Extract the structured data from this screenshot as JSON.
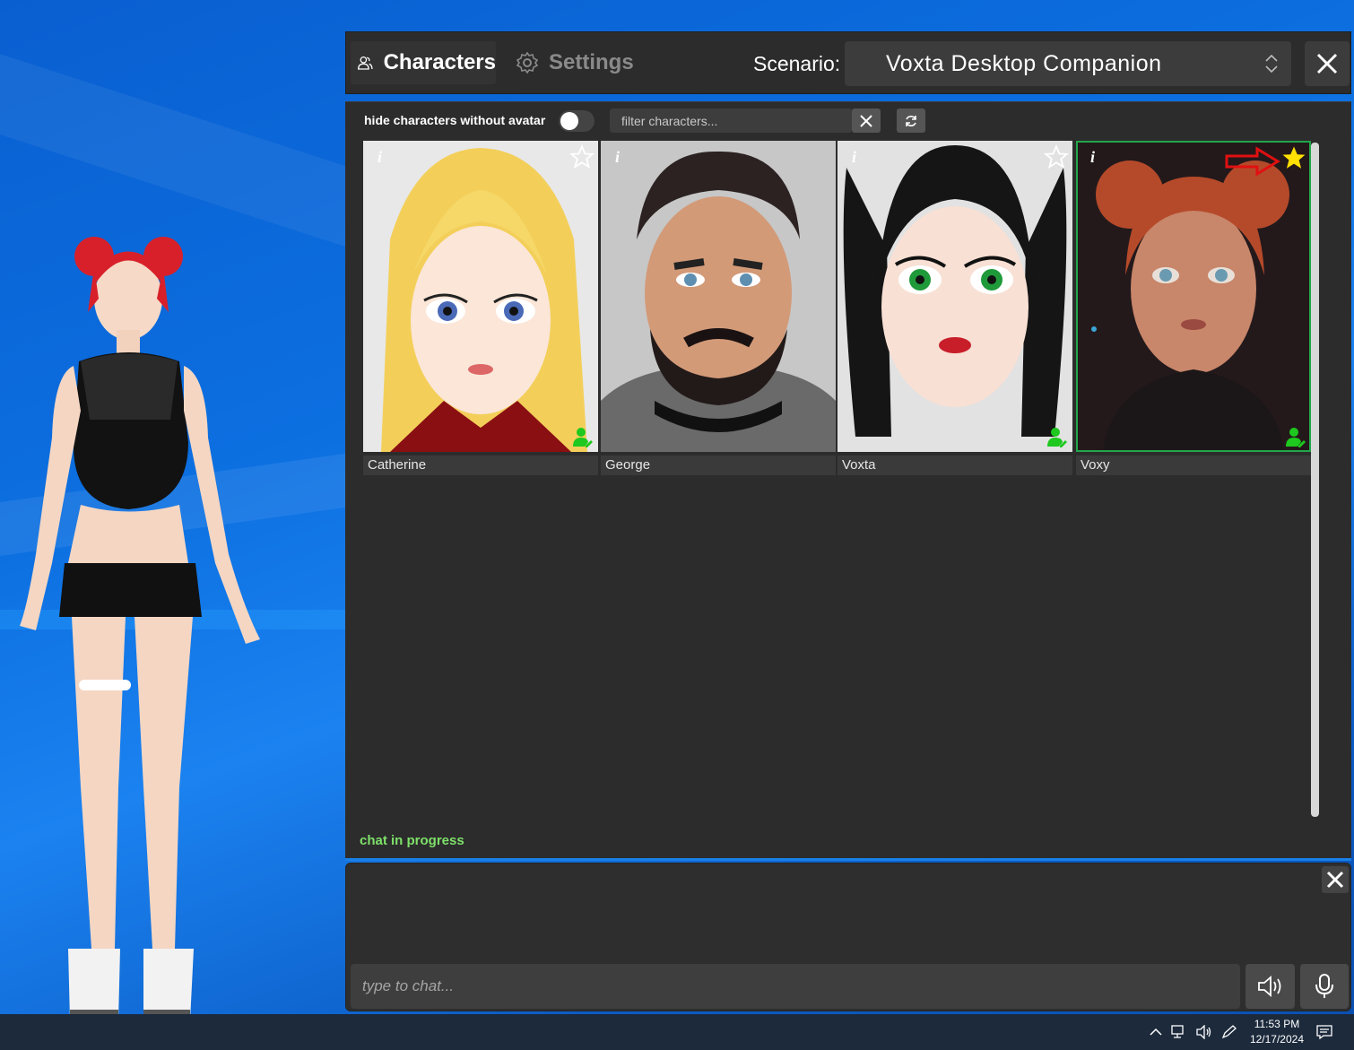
{
  "header": {
    "tabs": [
      {
        "label": "Characters",
        "active": true
      },
      {
        "label": "Settings",
        "active": false
      }
    ],
    "scenario_label": "Scenario:",
    "scenario_value": "Voxta Desktop Companion"
  },
  "filters": {
    "hide_without_avatar_label": "hide characters without avatar",
    "hide_without_avatar_on": false,
    "filter_placeholder": "filter characters..."
  },
  "characters": [
    {
      "name": "Catherine",
      "favorite": false,
      "selected": false
    },
    {
      "name": "George",
      "favorite": false,
      "selected": false
    },
    {
      "name": "Voxta",
      "favorite": false,
      "selected": false
    },
    {
      "name": "Voxy",
      "favorite": true,
      "selected": true
    }
  ],
  "card_info_glyph": "i",
  "status": {
    "text": "chat in progress",
    "color": "#7ee06a"
  },
  "chat": {
    "input_placeholder": "type to chat..."
  },
  "taskbar": {
    "time": "11:53 PM",
    "date": "12/17/2024"
  },
  "colors": {
    "accent_green": "#22a64a",
    "favorite_star": "#ffe000",
    "annotation_arrow": "#e01010"
  }
}
